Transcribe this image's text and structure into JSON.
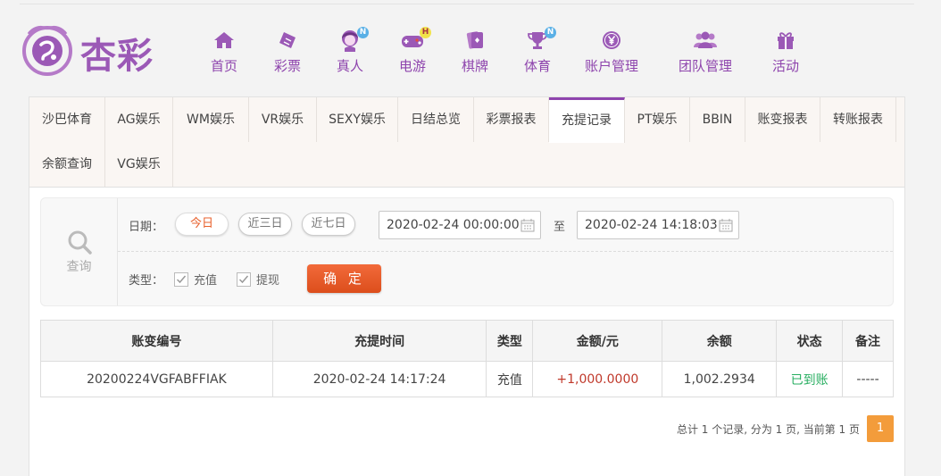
{
  "brand": {
    "name": "杏彩",
    "accent": "#8e44ad"
  },
  "nav": [
    {
      "label": "首页",
      "icon": "home-icon"
    },
    {
      "label": "彩票",
      "icon": "ticket-icon"
    },
    {
      "label": "真人",
      "icon": "live-dealer-icon",
      "badge": "N"
    },
    {
      "label": "电游",
      "icon": "gamepad-icon",
      "badge": "H"
    },
    {
      "label": "棋牌",
      "icon": "cards-icon"
    },
    {
      "label": "体育",
      "icon": "trophy-icon",
      "badge": "N"
    },
    {
      "label": "账户管理",
      "icon": "yen-coin-icon"
    },
    {
      "label": "团队管理",
      "icon": "team-icon"
    },
    {
      "label": "活动",
      "icon": "gift-icon"
    }
  ],
  "tabs": [
    "沙巴体育",
    "AG娱乐",
    "WM娱乐",
    "VR娱乐",
    "SEXY娱乐",
    "日结总览",
    "彩票报表",
    "充提记录",
    "PT娱乐",
    "BBIN",
    "账变报表",
    "转账报表",
    "余额查询",
    "VG娱乐"
  ],
  "active_tab": "充提记录",
  "filter": {
    "search_label": "查询",
    "date_label": "日期：",
    "date_options": [
      "今日",
      "近三日",
      "近七日"
    ],
    "date_active": "今日",
    "start_date": "2020-02-24 00:00:00",
    "to_label": "至",
    "end_date": "2020-02-24 14:18:03",
    "type_label": "类型：",
    "types": [
      {
        "label": "充值",
        "checked": true
      },
      {
        "label": "提现",
        "checked": true
      }
    ],
    "confirm_label": "确 定"
  },
  "table": {
    "headers": [
      "账变编号",
      "充提时间",
      "类型",
      "金额/元",
      "余额",
      "状态",
      "备注"
    ],
    "rows": [
      [
        "20200224VGFABFFIAK",
        "2020-02-24 14:17:24",
        "充值",
        "+1,000.0000",
        "1,002.2934",
        "已到账",
        "-----"
      ]
    ]
  },
  "pagination": {
    "summary": "总计 1 个记录, 分为 1 页, 当前第 1 页",
    "current": "1"
  }
}
